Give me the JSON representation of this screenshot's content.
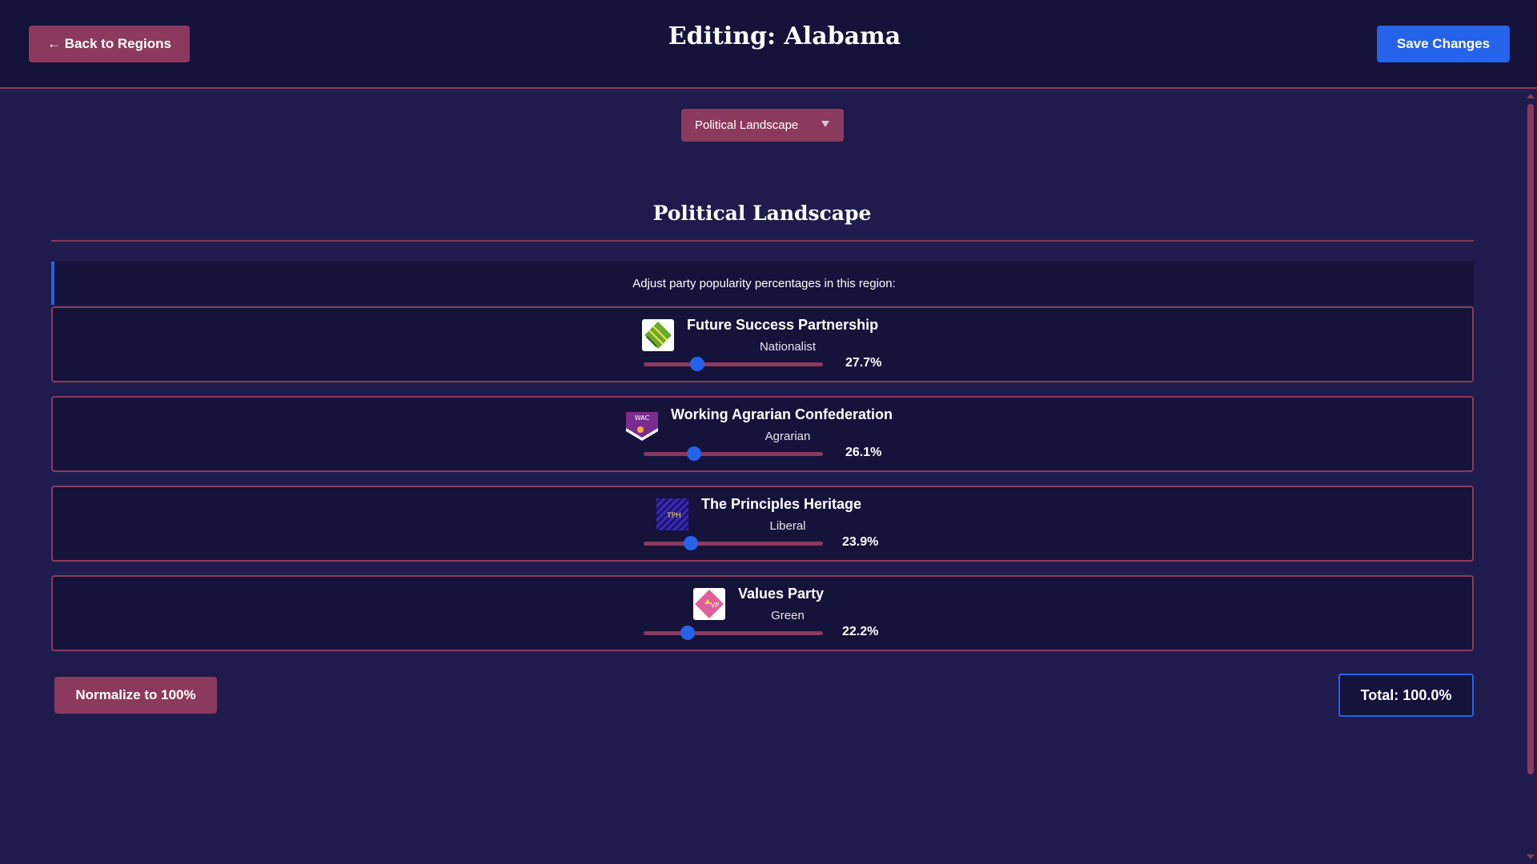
{
  "header": {
    "back_label": "← Back to Regions",
    "title": "Editing: Alabama",
    "save_label": "Save Changes"
  },
  "section_select": {
    "selected": "Political Landscape"
  },
  "section": {
    "heading": "Political Landscape",
    "instructions": "Adjust party popularity percentages in this region:"
  },
  "parties": [
    {
      "name": "Future Success Partnership",
      "ideology": "Nationalist",
      "percent_label": "27.7%",
      "value": 27.7,
      "logo_icon": "green-diamond-flag-icon"
    },
    {
      "name": "Working Agrarian Confederation",
      "ideology": "Agrarian",
      "percent_label": "26.1%",
      "value": 26.1,
      "logo_icon": "purple-shield-flag-icon"
    },
    {
      "name": "The Principles Heritage",
      "ideology": "Liberal",
      "percent_label": "23.9%",
      "value": 23.9,
      "logo_icon": "blue-striped-flag-icon"
    },
    {
      "name": "Values Party",
      "ideology": "Green",
      "percent_label": "22.2%",
      "value": 22.2,
      "logo_icon": "pink-diamond-flag-icon"
    }
  ],
  "footer": {
    "normalize_label": "Normalize to 100%",
    "total_label": "Total: 100.0%"
  },
  "colors": {
    "background": "#1f1c4d",
    "panel": "#15133a",
    "accent_maroon": "#8b3a5e",
    "accent_blue": "#2563eb"
  }
}
